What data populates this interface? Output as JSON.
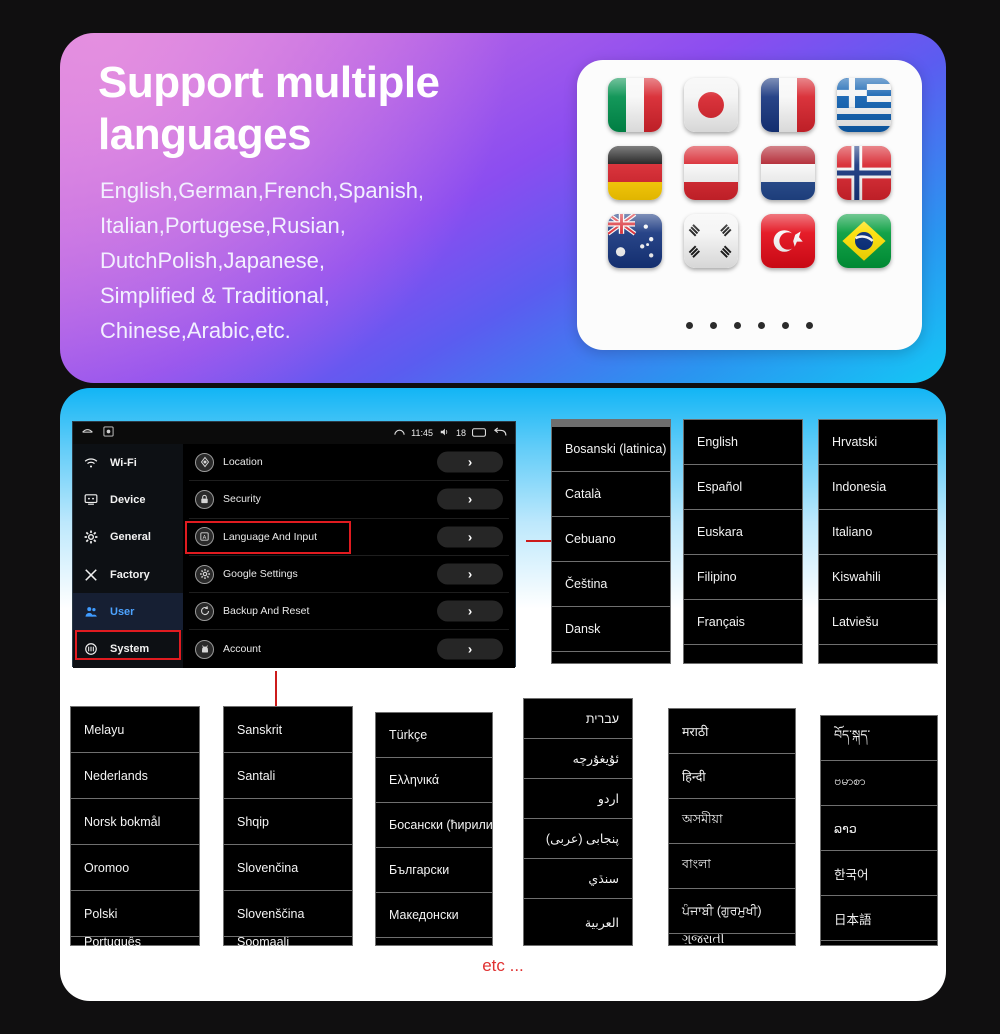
{
  "hero": {
    "title_line1": "Support multiple",
    "title_line2": "languages",
    "lines": [
      "English,German,French,Spanish,",
      "Italian,Portugese,Rusian,",
      "DutchPolish,Japanese,",
      "Simplified & Traditional,",
      "Chinese,Arabic,etc."
    ],
    "flags": [
      {
        "name": "flag-italy",
        "label": "Italy"
      },
      {
        "name": "flag-japan",
        "label": "Japan"
      },
      {
        "name": "flag-france",
        "label": "France"
      },
      {
        "name": "flag-greece",
        "label": "Greece"
      },
      {
        "name": "flag-germany",
        "label": "Germany"
      },
      {
        "name": "flag-austria",
        "label": "Austria"
      },
      {
        "name": "flag-netherlands",
        "label": "Netherlands"
      },
      {
        "name": "flag-norway",
        "label": "Norway"
      },
      {
        "name": "flag-australia",
        "label": "Australia"
      },
      {
        "name": "flag-south-korea",
        "label": "South Korea"
      },
      {
        "name": "flag-turkey",
        "label": "Turkey"
      },
      {
        "name": "flag-brazil",
        "label": "Brazil"
      }
    ],
    "dots_count": 6
  },
  "headunit": {
    "status": {
      "time": "11:45",
      "volume": "18"
    },
    "sidebar": [
      {
        "label": "Wi-Fi",
        "icon": "wifi-icon",
        "active": false
      },
      {
        "label": "Device",
        "icon": "device-icon",
        "active": false
      },
      {
        "label": "General",
        "icon": "gear-icon",
        "active": false
      },
      {
        "label": "Factory",
        "icon": "tools-icon",
        "active": false
      },
      {
        "label": "User",
        "icon": "user-icon",
        "active": true
      },
      {
        "label": "System",
        "icon": "system-icon",
        "active": false
      }
    ],
    "rows": [
      {
        "label": "Location",
        "icon": "location-icon",
        "chevron": "›",
        "highlighted": false
      },
      {
        "label": "Security",
        "icon": "lock-icon",
        "chevron": "›",
        "highlighted": false
      },
      {
        "label": "Language And Input",
        "icon": "language-icon",
        "chevron": "›",
        "highlighted": true
      },
      {
        "label": "Google Settings",
        "icon": "gear-icon",
        "chevron": "›",
        "highlighted": false
      },
      {
        "label": "Backup And Reset",
        "icon": "backup-icon",
        "chevron": "›",
        "highlighted": false
      },
      {
        "label": "Account",
        "icon": "android-icon",
        "chevron": "›",
        "highlighted": false
      }
    ]
  },
  "language_columns": [
    {
      "id": "col-1",
      "scroll_head": true,
      "items": [
        "Bosanski (latinica)",
        "Català",
        "Cebuano",
        "Čeština",
        "Dansk",
        ""
      ]
    },
    {
      "id": "col-2",
      "scroll_head": false,
      "items": [
        "English",
        "Español",
        "Euskara",
        "Filipino",
        "Français",
        ""
      ]
    },
    {
      "id": "col-3",
      "scroll_head": false,
      "items": [
        "Hrvatski",
        "Indonesia",
        "Italiano",
        "Kiswahili",
        "Latviešu",
        ""
      ]
    },
    {
      "id": "col-4",
      "scroll_head": false,
      "items": [
        "Melayu",
        "Nederlands",
        "Norsk bokmål",
        "Oromoo",
        "Polski",
        "Português"
      ]
    },
    {
      "id": "col-5",
      "scroll_head": false,
      "items": [
        "Sanskrit",
        "Santali",
        "Shqip",
        "Slovenčina",
        "Slovenščina",
        "Soomaali"
      ]
    },
    {
      "id": "col-6",
      "scroll_head": false,
      "items": [
        "Türkçe",
        "Ελληνικά",
        "Босански (ћирилиц",
        "Български",
        "Македонски",
        ""
      ]
    },
    {
      "id": "col-7",
      "scroll_head": false,
      "items": [
        "עברית",
        "ئۇيغۇرچە",
        "اردو",
        "پنجابی (عربی)",
        "سنڌي",
        "العربية"
      ]
    },
    {
      "id": "col-8",
      "scroll_head": false,
      "items": [
        "मराठी",
        "हिन्दी",
        "অসমীয়া",
        "বাংলা",
        "ਪੰਜਾਬੀ (ਗੁਰਮੁਖੀ)",
        "ગુજરાતી"
      ]
    },
    {
      "id": "col-9",
      "scroll_head": false,
      "items": [
        "བོད་སྐད་",
        "ဗမာစာ",
        "ລາວ",
        "한국어",
        "日本語",
        ""
      ]
    }
  ],
  "footer": {
    "etc_label": "etc ..."
  },
  "colors": {
    "page_background": "#100f10",
    "hero_gradient_start": "#d983e2",
    "hero_gradient_end": "#14c8f5",
    "lower_gradient_start": "#12b5f5",
    "lower_gradient_end": "#ffffff",
    "accent_red": "#e01b20",
    "active_blue": "#4da3ff"
  }
}
